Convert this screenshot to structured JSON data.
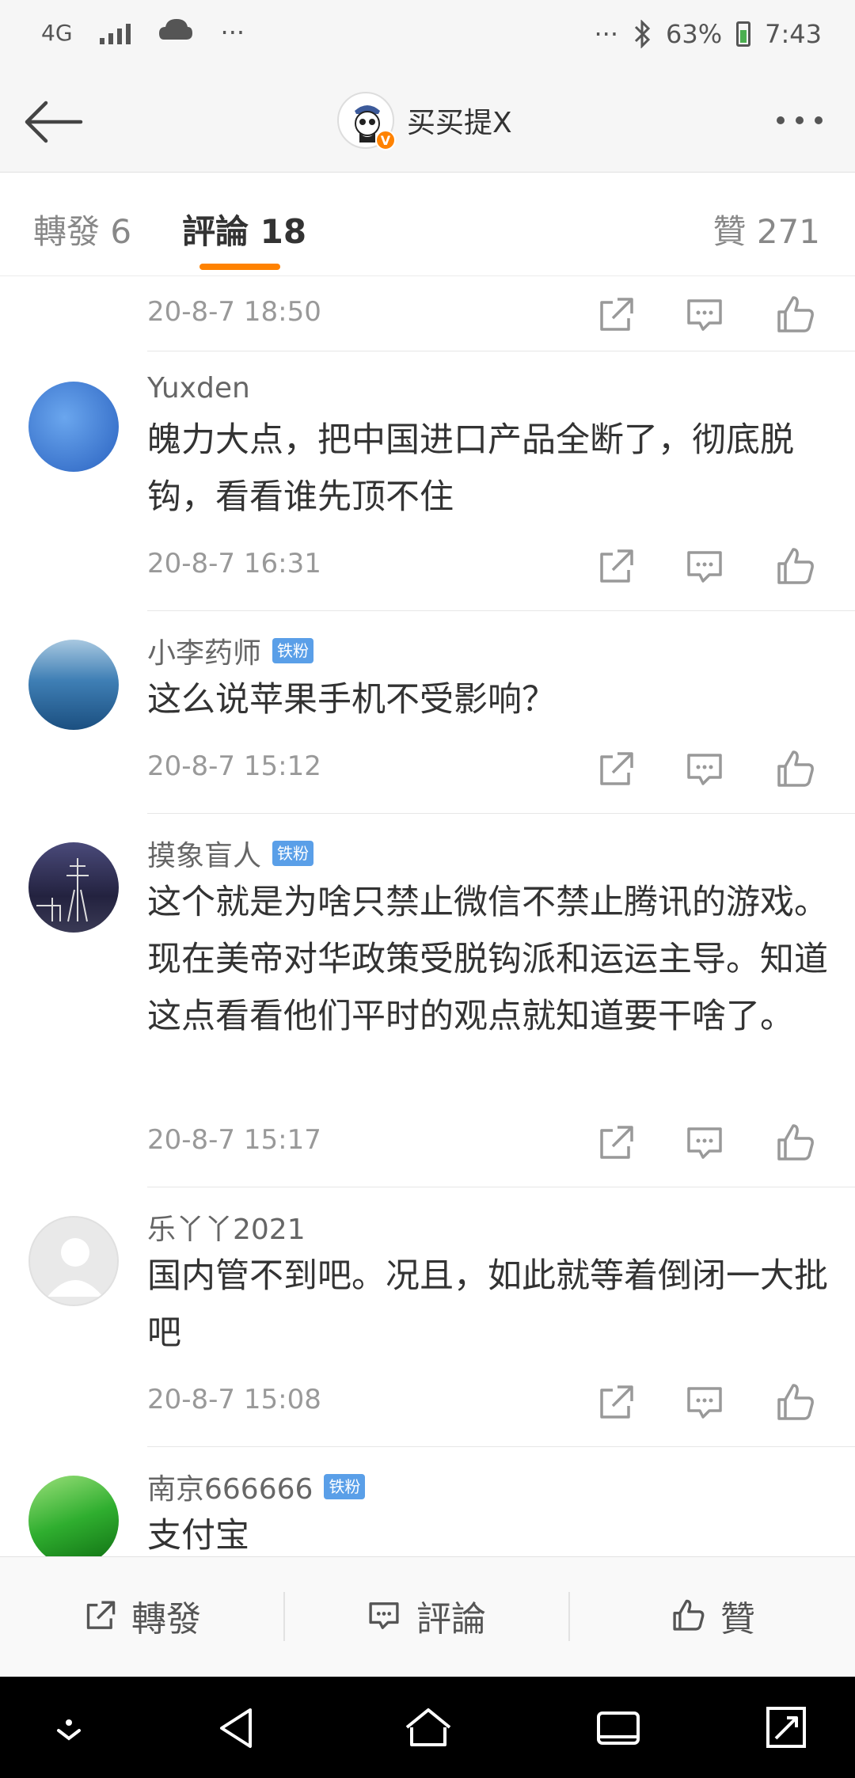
{
  "status_bar": {
    "network": "4G",
    "left_dots": "···",
    "right_dots": "···",
    "battery": "63%",
    "time": "7:43"
  },
  "nav": {
    "title": "买买提X",
    "avatar_icon": "cartoon-avatar-icon",
    "verified_badge": "V"
  },
  "tabs": [
    {
      "label": "轉發 6"
    },
    {
      "label": "評論 18",
      "active": true
    },
    {
      "label": "贊 271"
    }
  ],
  "comments": [
    {
      "time": "20-8-7 18:50"
    },
    {
      "user": "Yuxden",
      "text": "魄力大点，把中国进口产品全断了，彻底脱钩，看看谁先顶不住",
      "time": "20-8-7 16:31",
      "avatar_color": "#3f7fd6"
    },
    {
      "user": "小李药师",
      "badge": "铁粉",
      "text": "这么说苹果手机不受影响？",
      "time": "20-8-7 15:12",
      "avatar_color": "#2a6aa8"
    },
    {
      "user": "摸象盲人",
      "badge": "铁粉",
      "text": "这个就是为啥只禁止微信不禁止腾讯的游戏。现在美帝对华政策受脱钩派和运运主导。知道这点看看他们平时的观点就知道要干啥了。",
      "time": "20-8-7 15:17",
      "avatar_color": "#2b2a4a"
    },
    {
      "user": "乐丫丫2021",
      "text": "国内管不到吧。况且，如此就等着倒闭一大批吧",
      "time": "20-8-7 15:08",
      "avatar_color": "#e6e6e6"
    },
    {
      "user": "南京666666",
      "badge": "铁粉",
      "text": "支付宝",
      "avatar_color": "#3cb83c"
    }
  ],
  "bottom_bar": {
    "repost_label": "轉發",
    "comment_label": "評論",
    "like_label": "贊"
  },
  "icons": {
    "back": "back-arrow-icon",
    "more": "more-dots-icon",
    "share": "share-icon",
    "comment": "comment-icon",
    "like": "thumbs-up-icon"
  },
  "colors": {
    "accent": "#ff8200",
    "fan_badge": "#5a9fe8"
  }
}
